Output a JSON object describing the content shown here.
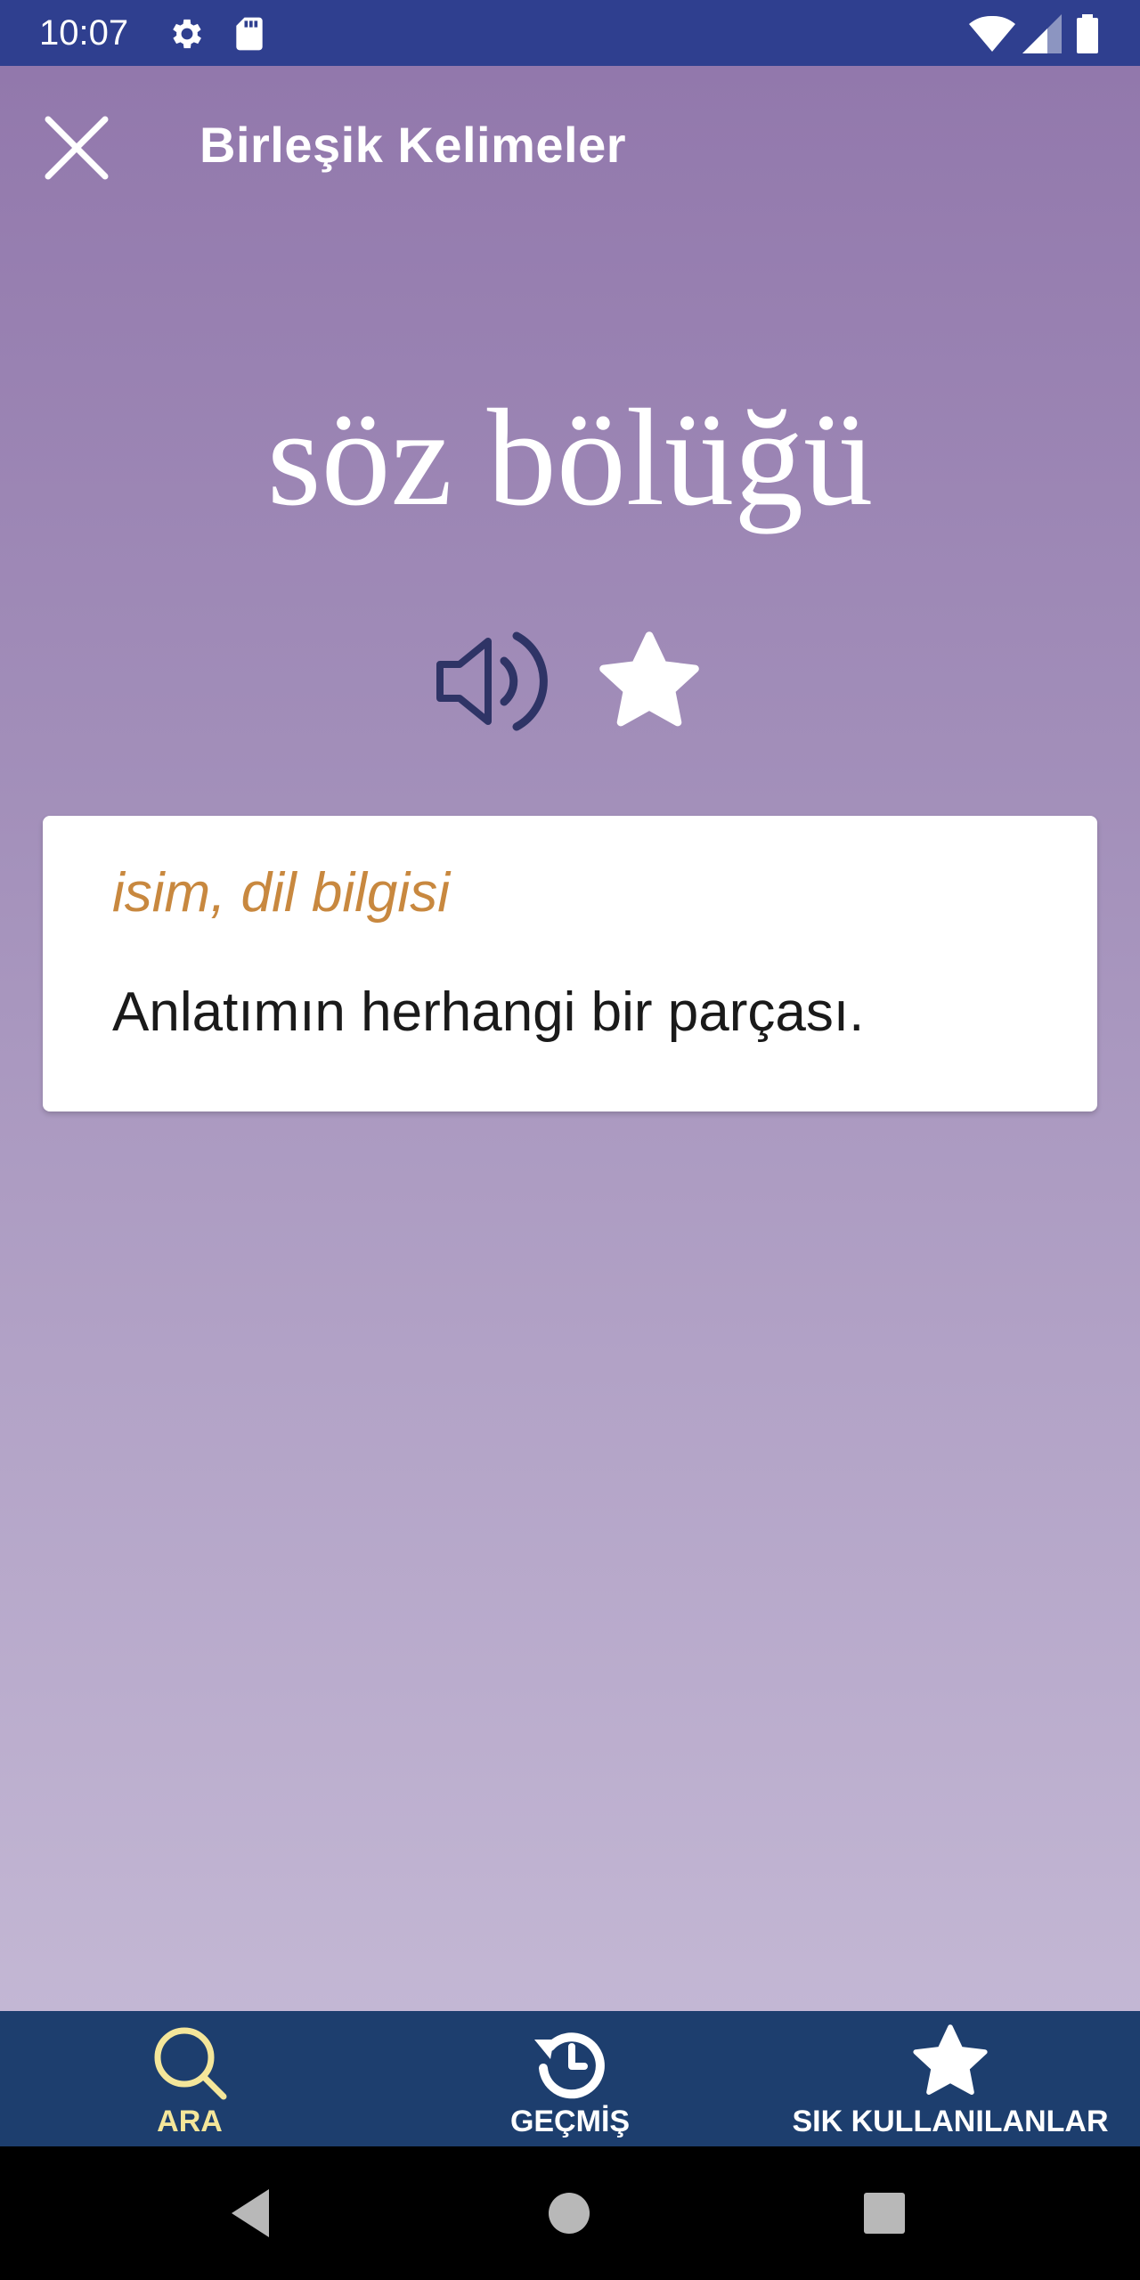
{
  "status_bar": {
    "time": "10:07",
    "icons": [
      "settings-icon",
      "sd-card-icon",
      "wifi-icon",
      "signal-icon",
      "battery-icon"
    ],
    "background": "#2f3f8f"
  },
  "topbar": {
    "close_icon": "close-icon",
    "title": "Birleşik Kelimeler"
  },
  "entry": {
    "word": "söz bölüğü",
    "speaker_icon": "speaker-icon",
    "favorite_icon": "star-icon",
    "part_of_speech": "isim, dil bilgisi",
    "definition": "Anlatımın herhangi bir parçası."
  },
  "bottom_nav": {
    "items": [
      {
        "label": "ARA",
        "icon": "search-icon",
        "active": true
      },
      {
        "label": "GEÇMİŞ",
        "icon": "history-icon",
        "active": false
      },
      {
        "label": "SIK KULLANILANLAR",
        "icon": "star-icon",
        "active": false
      }
    ],
    "background": "#1d3e6e",
    "active_color": "#f4e69a"
  },
  "system_nav": {
    "icons": [
      "back-icon",
      "home-icon",
      "recents-icon"
    ]
  },
  "colors": {
    "accent_pos": "#c8883f",
    "speaker_icon": "#2f3466",
    "gradient_top": "#9278ac",
    "gradient_bottom": "#c3b7d4"
  }
}
